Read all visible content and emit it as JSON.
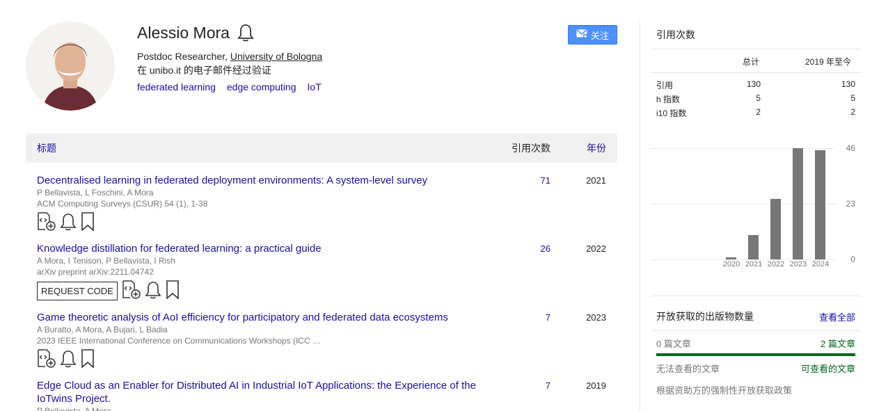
{
  "profile": {
    "name": "Alessio Mora",
    "affiliation_role": "Postdoc Researcher, ",
    "affiliation_org": "University of Bologna",
    "verified": "在 unibo.it 的电子邮件经过验证",
    "interests": [
      "federated learning",
      "edge computing",
      "IoT"
    ],
    "follow_label": "关注"
  },
  "table": {
    "header_title": "标题",
    "header_citations": "引用次数",
    "header_year": "年份",
    "rows": [
      {
        "title": "Decentralised learning in federated deployment environments: A system-level survey",
        "authors": "P Bellavista, L Foschini, A Mora",
        "venue": "ACM Computing Surveys (CSUR) 54 (1), 1-38",
        "citations": "71",
        "year": "2021"
      },
      {
        "title": "Knowledge distillation for federated learning: a practical guide",
        "authors": "A Mora, I Tenison, P Bellavista, I Rish",
        "venue": "arXiv preprint arXiv:2211.04742",
        "citations": "26",
        "year": "2022",
        "request_label": "REQUEST CODE"
      },
      {
        "title": "Game theoretic analysis of AoI efficiency for participatory and federated data ecosystems",
        "authors": "A Buratto, A Mora, A Bujari, L Badia",
        "venue": "2023 IEEE International Conference on Communications Workshops (ICC …",
        "citations": "7",
        "year": "2023"
      },
      {
        "title": "Edge Cloud as an Enabler for Distributed AI in Industrial IoT Applications: the Experience of the IoTwins Project.",
        "authors": "P Bellavista, A Mora",
        "venue": "",
        "citations": "7",
        "year": "2019"
      }
    ]
  },
  "cited_by": {
    "title": "引用次数",
    "col_all": "总计",
    "col_since": "2019 年至今",
    "rows": [
      {
        "label": "引用",
        "all": "130",
        "since": "130"
      },
      {
        "label": "h 指数",
        "all": "5",
        "since": "5"
      },
      {
        "label": "i10 指数",
        "all": "2",
        "since": "2"
      }
    ]
  },
  "chart_data": {
    "type": "bar",
    "categories": [
      "2020",
      "2021",
      "2022",
      "2023",
      "2024"
    ],
    "values": [
      1,
      10,
      25,
      46,
      45
    ],
    "ylim": [
      0,
      46
    ],
    "yticks": [
      "46",
      "23",
      "0"
    ],
    "grid": true
  },
  "open_access": {
    "title": "开放获取的出版物数量",
    "view_all": "查看全部",
    "left_count": "0 篇文章",
    "right_count": "2 篇文章",
    "left_label": "无法查看的文章",
    "right_label": "可查看的文章",
    "policy": "根据资助方的强制性开放获取政策",
    "available_fraction": 1.0
  }
}
